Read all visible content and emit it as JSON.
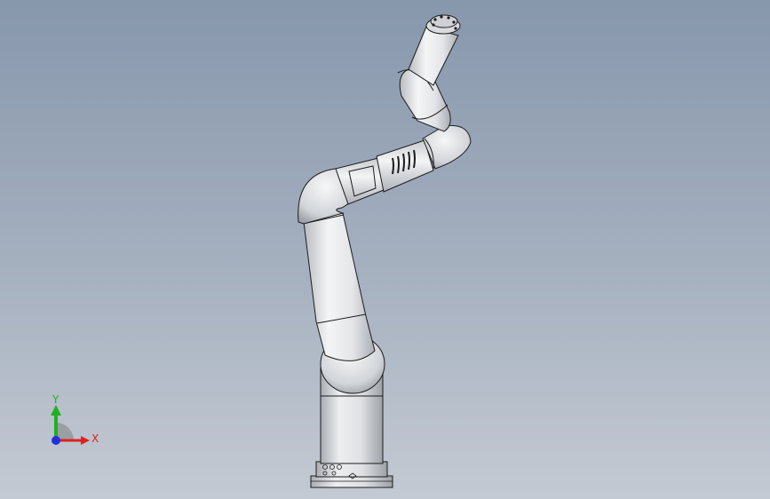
{
  "viewport": {
    "background_top": "#8797ac",
    "background_bottom": "#c4cad3"
  },
  "model": {
    "body_color": "#e3e4e6",
    "edge_color": "#1c1c1c"
  },
  "triad": {
    "x_label": "X",
    "y_label": "Y",
    "x_color": "#e02020",
    "y_color": "#20b020",
    "z_color": "#2030e0"
  }
}
